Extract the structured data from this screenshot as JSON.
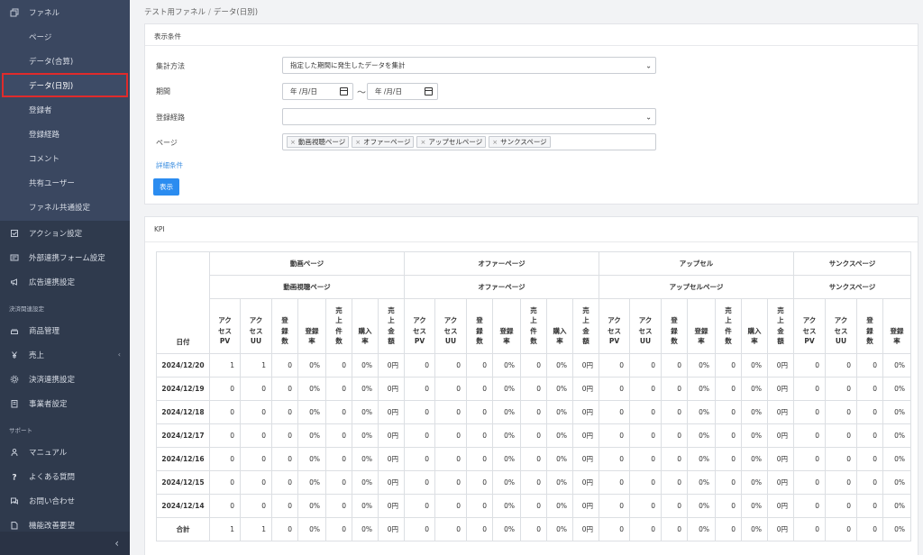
{
  "sidebar": {
    "funnel_label": "ファネル",
    "funnel_items": [
      {
        "label": "ページ",
        "active": false
      },
      {
        "label": "データ(合算)",
        "active": false
      },
      {
        "label": "データ(日別)",
        "active": true
      },
      {
        "label": "登録者",
        "active": false
      },
      {
        "label": "登録経路",
        "active": false
      },
      {
        "label": "コメント",
        "active": false
      },
      {
        "label": "共有ユーザー",
        "active": false
      },
      {
        "label": "ファネル共通設定",
        "active": false
      }
    ],
    "main_items": [
      {
        "label": "アクション設定",
        "icon": "checkbox-icon"
      },
      {
        "label": "外部連携フォーム設定",
        "icon": "form-icon"
      },
      {
        "label": "広告連携設定",
        "icon": "megaphone-icon"
      }
    ],
    "payment_header": "決済関連設定",
    "payment_items": [
      {
        "label": "商品管理",
        "icon": "cake-icon"
      },
      {
        "label": "売上",
        "icon": "yen-icon",
        "has_caret": true
      },
      {
        "label": "決済連携設定",
        "icon": "gear-icon"
      },
      {
        "label": "事業者設定",
        "icon": "building-icon"
      }
    ],
    "support_header": "サポート",
    "support_items": [
      {
        "label": "マニュアル",
        "icon": "person-icon"
      },
      {
        "label": "よくある質問",
        "icon": "question-icon"
      },
      {
        "label": "お問い合わせ",
        "icon": "chat-icon"
      },
      {
        "label": "機能改善要望",
        "icon": "document-icon"
      }
    ],
    "collapse_glyph": "‹"
  },
  "breadcrumb": {
    "parent": "テスト用ファネル",
    "separator": "/",
    "current": "データ(日別)"
  },
  "conditions": {
    "title": "表示条件",
    "method_label": "集計方法",
    "method_value": "指定した期間に発生したデータを集計",
    "period_label": "期間",
    "date_placeholder": "年 /月/日",
    "tilde": "〜",
    "route_label": "登録経路",
    "route_value": "",
    "page_label": "ページ",
    "page_tags": [
      "動画視聴ページ",
      "オファーページ",
      "アップセルページ",
      "サンクスページ"
    ],
    "detail_link": "詳細条件",
    "show_button": "表示"
  },
  "kpi": {
    "title": "KPI",
    "date_header": "日付",
    "groups": [
      {
        "name": "動画ページ",
        "sub": "動画視聴ページ",
        "cols": 7
      },
      {
        "name": "オファーページ",
        "sub": "オファーページ",
        "cols": 7
      },
      {
        "name": "アップセル",
        "sub": "アップセルページ",
        "cols": 7
      },
      {
        "name": "サンクスページ",
        "sub": "サンクスページ",
        "cols": 4
      }
    ],
    "columns": [
      [
        "アク",
        "セス",
        "PV"
      ],
      [
        "アク",
        "セス",
        "UU"
      ],
      [
        "登",
        "録",
        "数"
      ],
      [
        "登録",
        "率"
      ],
      [
        "売",
        "上",
        "件",
        "数"
      ],
      [
        "購入",
        "率"
      ],
      [
        "売",
        "上",
        "金",
        "額"
      ]
    ],
    "thanks_columns": [
      [
        "アク",
        "セス",
        "PV"
      ],
      [
        "アク",
        "セス",
        "UU"
      ],
      [
        "登",
        "録",
        "数"
      ],
      [
        "登録",
        "率"
      ]
    ],
    "rows": [
      {
        "date": "2024/12/20",
        "values": [
          "1",
          "1",
          "0",
          "0%",
          "0",
          "0%",
          "0円",
          "0",
          "0",
          "0",
          "0%",
          "0",
          "0%",
          "0円",
          "0",
          "0",
          "0",
          "0%",
          "0",
          "0%",
          "0円",
          "0",
          "0",
          "0",
          "0%"
        ]
      },
      {
        "date": "2024/12/19",
        "values": [
          "0",
          "0",
          "0",
          "0%",
          "0",
          "0%",
          "0円",
          "0",
          "0",
          "0",
          "0%",
          "0",
          "0%",
          "0円",
          "0",
          "0",
          "0",
          "0%",
          "0",
          "0%",
          "0円",
          "0",
          "0",
          "0",
          "0%"
        ]
      },
      {
        "date": "2024/12/18",
        "values": [
          "0",
          "0",
          "0",
          "0%",
          "0",
          "0%",
          "0円",
          "0",
          "0",
          "0",
          "0%",
          "0",
          "0%",
          "0円",
          "0",
          "0",
          "0",
          "0%",
          "0",
          "0%",
          "0円",
          "0",
          "0",
          "0",
          "0%"
        ]
      },
      {
        "date": "2024/12/17",
        "values": [
          "0",
          "0",
          "0",
          "0%",
          "0",
          "0%",
          "0円",
          "0",
          "0",
          "0",
          "0%",
          "0",
          "0%",
          "0円",
          "0",
          "0",
          "0",
          "0%",
          "0",
          "0%",
          "0円",
          "0",
          "0",
          "0",
          "0%"
        ]
      },
      {
        "date": "2024/12/16",
        "values": [
          "0",
          "0",
          "0",
          "0%",
          "0",
          "0%",
          "0円",
          "0",
          "0",
          "0",
          "0%",
          "0",
          "0%",
          "0円",
          "0",
          "0",
          "0",
          "0%",
          "0",
          "0%",
          "0円",
          "0",
          "0",
          "0",
          "0%"
        ]
      },
      {
        "date": "2024/12/15",
        "values": [
          "0",
          "0",
          "0",
          "0%",
          "0",
          "0%",
          "0円",
          "0",
          "0",
          "0",
          "0%",
          "0",
          "0%",
          "0円",
          "0",
          "0",
          "0",
          "0%",
          "0",
          "0%",
          "0円",
          "0",
          "0",
          "0",
          "0%"
        ]
      },
      {
        "date": "2024/12/14",
        "values": [
          "0",
          "0",
          "0",
          "0%",
          "0",
          "0%",
          "0円",
          "0",
          "0",
          "0",
          "0%",
          "0",
          "0%",
          "0円",
          "0",
          "0",
          "0",
          "0%",
          "0",
          "0%",
          "0円",
          "0",
          "0",
          "0",
          "0%"
        ]
      },
      {
        "date": "合計",
        "values": [
          "1",
          "1",
          "0",
          "0%",
          "0",
          "0%",
          "0円",
          "0",
          "0",
          "0",
          "0%",
          "0",
          "0%",
          "0円",
          "0",
          "0",
          "0",
          "0%",
          "0",
          "0%",
          "0円",
          "0",
          "0",
          "0",
          "0%"
        ]
      }
    ]
  },
  "colors": {
    "sidebar_bg": "#2f3a4d",
    "active_border": "#e02b2b",
    "primary_button": "#2b8cf0",
    "link": "#3a8de0"
  }
}
